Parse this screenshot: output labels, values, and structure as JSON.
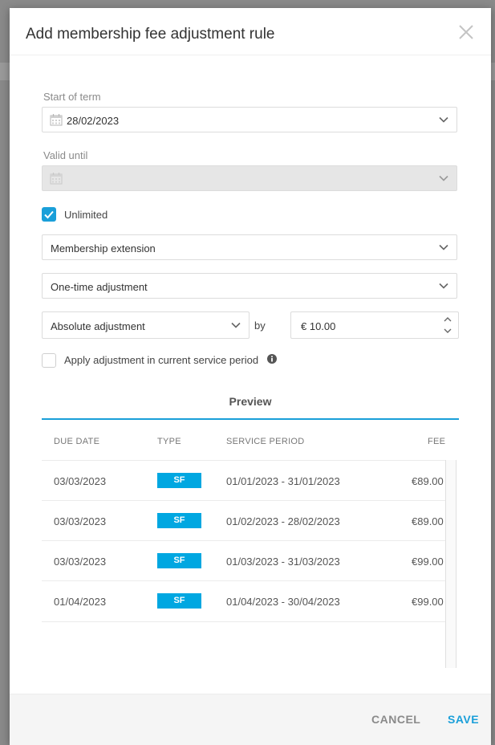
{
  "dialog": {
    "title": "Add membership fee adjustment rule"
  },
  "form": {
    "start_label": "Start of term",
    "start_value": "28/02/2023",
    "valid_until_label": "Valid until",
    "valid_until_value": "",
    "unlimited_label": "Unlimited",
    "unlimited_checked": true,
    "category_value": "Membership extension",
    "frequency_value": "One-time adjustment",
    "adjustment_type_value": "Absolute adjustment",
    "by_label": "by",
    "amount_value": "€ 10.00",
    "apply_current_label": "Apply adjustment in current service period",
    "apply_current_checked": false
  },
  "preview": {
    "title": "Preview",
    "columns": [
      "DUE DATE",
      "TYPE",
      "SERVICE PERIOD",
      "FEE"
    ],
    "rows": [
      {
        "due": "03/03/2023",
        "type": "SF",
        "period": "01/01/2023 - 31/01/2023",
        "fee": "€89.00"
      },
      {
        "due": "03/03/2023",
        "type": "SF",
        "period": "01/02/2023 - 28/02/2023",
        "fee": "€89.00"
      },
      {
        "due": "03/03/2023",
        "type": "SF",
        "period": "01/03/2023 - 31/03/2023",
        "fee": "€99.00"
      },
      {
        "due": "01/04/2023",
        "type": "SF",
        "period": "01/04/2023 - 30/04/2023",
        "fee": "€99.00"
      }
    ]
  },
  "footer": {
    "cancel_label": "CANCEL",
    "save_label": "SAVE"
  },
  "colors": {
    "accent": "#1a9fd9",
    "badge": "#00a7e1"
  }
}
